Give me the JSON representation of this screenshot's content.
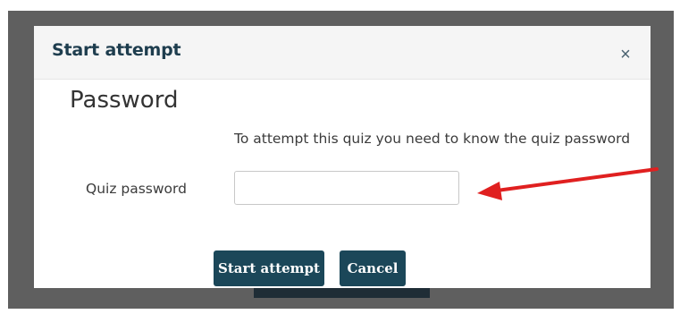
{
  "modal": {
    "title": "Start attempt",
    "close_glyph": "×",
    "section_heading": "Password",
    "info_text": "To attempt this quiz you need to know the quiz password",
    "field_label": "Quiz password",
    "password_value": "",
    "start_button_label": "Start attempt",
    "cancel_button_label": "Cancel"
  },
  "annotation": {
    "arrow_color": "#e02020",
    "arrow_icon": "red-arrow-pointing-left"
  },
  "colors": {
    "button_bg": "#1b4759",
    "title_color": "#1e3d4e",
    "backdrop": "#5f5f5f"
  }
}
